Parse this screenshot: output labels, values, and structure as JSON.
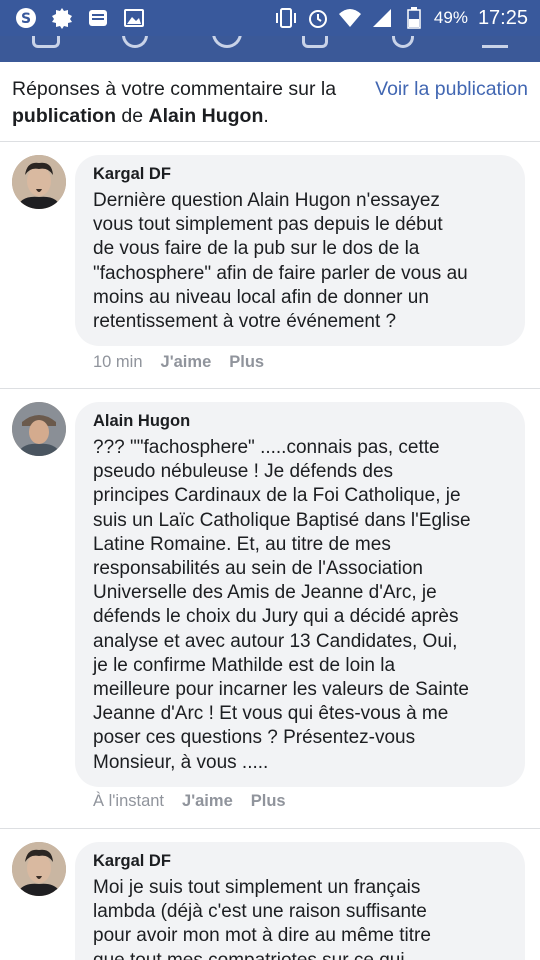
{
  "status_bar": {
    "battery_percent": "49%",
    "time": "17:25",
    "left_icons": [
      "s-app-icon",
      "gear-icon",
      "message-icon",
      "image-icon"
    ],
    "right_icons": [
      "vibrate-icon",
      "alarm-icon",
      "wifi-icon",
      "signal-icon",
      "battery-icon"
    ]
  },
  "header": {
    "prefix": "Réponses à votre commentaire sur la ",
    "publication_word": "publication",
    "middle": " de ",
    "author_name": "Alain Hugon",
    "suffix": ".",
    "view_link": "Voir la publication"
  },
  "comments": [
    {
      "author": "Kargal DF",
      "text": "Dernière question Alain Hugon n'essayez\nvous tout simplement pas depuis le début\nde vous faire de la pub sur le dos de la\n\"fachosphere\" afin de faire parler de vous au\nmoins au niveau local afin de donner un\nretentissement à votre événement ?",
      "time": "10 min",
      "like": "J'aime",
      "more": "Plus"
    },
    {
      "author": "Alain Hugon",
      "text": "??? \"\"fachosphere\" .....connais pas, cette\npseudo nébuleuse ! Je défends des\nprincipes Cardinaux de la Foi Catholique, je\nsuis un Laïc Catholique Baptisé dans l'Eglise\nLatine Romaine. Et, au titre de mes\nresponsabilités au sein de l'Association\nUniverselle des Amis de Jeanne d'Arc, je\ndéfends le choix du Jury qui a décidé après\nanalyse et avec autour 13 Candidates, Oui,\nje le confirme Mathilde est de loin la\nmeilleure pour incarner les valeurs de Sainte\nJeanne d'Arc ! Et vous qui êtes-vous à me\nposer ces questions ? Présentez-vous\nMonsieur, à vous .....",
      "time": "À l'instant",
      "like": "J'aime",
      "more": "Plus"
    },
    {
      "author": "Kargal DF",
      "text": "Moi je suis tout simplement un français\nlambda (déjà c'est une raison suffisante\npour avoir mon mot à dire au même titre\nque tout mes compatriotes sur ce qui",
      "time": "",
      "like": "",
      "more": ""
    }
  ]
}
